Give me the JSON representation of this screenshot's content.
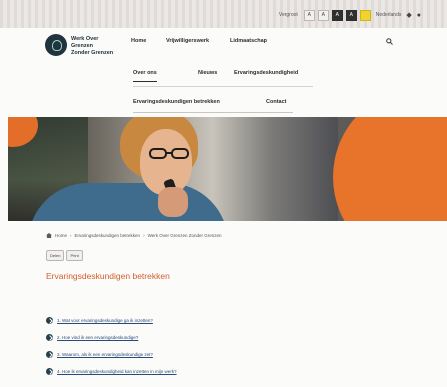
{
  "topbar": {
    "tools_label": "Vergroot",
    "buttons": [
      "A",
      "A",
      "A",
      "A"
    ],
    "lang": "Nederlands",
    "symbols": [
      "◆",
      "●"
    ]
  },
  "header": {
    "brand_line1": "Werk Over Grenzen",
    "brand_line2": "Zonder Grenzen",
    "nav_primary": [
      "Home",
      "Vrijwilligerswerk",
      "Lidmaatschap"
    ],
    "nav_secondary": [
      "Over ons",
      "Nieuws",
      "Ervaringsdeskundigheid"
    ],
    "nav_tertiary": [
      "Ervaringsdeskundigen betrekken",
      "Contact"
    ]
  },
  "breadcrumb": {
    "home": "Home",
    "items": [
      "Ervaringsdeskundigen betrekken",
      "Werk Over Grenzen Zonder Grenzen"
    ]
  },
  "actions": {
    "share_label": "Delen",
    "print_label": "Print"
  },
  "page": {
    "title": "Ervaringsdeskundigen betrekken"
  },
  "toc": [
    "1. Wat voor ervaringsdeskundige ga ik inzetten?",
    "2. Hoe vind ik een ervaringsdeskundige?",
    "3. Waarom, als ik een ervaringsdeskundige zet?",
    "4. Hoe ik ervaringsdeskundigheid kan inzetten in mijn werk?"
  ],
  "colors": {
    "accent": "#d25f2c",
    "brand_dark": "#20343e",
    "hero_orange": "#e8732b"
  }
}
